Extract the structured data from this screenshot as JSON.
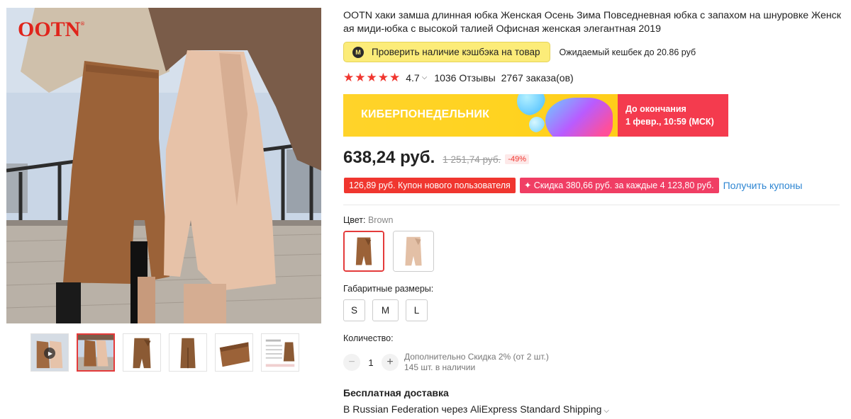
{
  "gallery": {
    "brand_logo": "OOTN",
    "thumbnails": [
      {
        "name": "thumb-video",
        "has_video": true
      },
      {
        "name": "thumb-two-models",
        "active": true
      },
      {
        "name": "thumb-brown-front"
      },
      {
        "name": "thumb-brown-side"
      },
      {
        "name": "thumb-fabric-detail"
      },
      {
        "name": "thumb-size-chart"
      }
    ]
  },
  "product": {
    "title": "OOTN хаки замша длинная юбка Женская Осень Зима Повседневная юбка с запахом на шнуровке Женская миди-юбка с высокой талией Офисная женская элегантная 2019",
    "cashback_button": "Проверить наличие кэшбэка на товар",
    "cashback_icon_letter": "M",
    "cashback_note": "Ожидаемый кешбек до 20.86 руб",
    "rating": "4.7",
    "reviews": "1036 Отзывы",
    "orders": "2767 заказа(ов)"
  },
  "promo": {
    "title": "КИБЕРПОНЕДЕЛЬНИК",
    "countdown_line1": "До окончания",
    "countdown_line2": "1 февр., 10:59 (МСК)"
  },
  "pricing": {
    "price": "638,24 руб.",
    "old_price": "1 251,74 руб.",
    "discount": "-49%"
  },
  "coupons": {
    "new_user": "126,89 руб. Купон нового пользователя",
    "store_discount": "✦ Скидка 380,66 руб. за каждые 4 123,80 руб.",
    "get_link": "Получить купоны"
  },
  "options": {
    "color_label": "Цвет: ",
    "color_value": "Brown",
    "size_label": "Габаритные размеры:",
    "sizes": [
      "S",
      "M",
      "L"
    ]
  },
  "quantity": {
    "label": "Количество:",
    "value": "1",
    "minus": "−",
    "plus": "+",
    "discount_note": "Дополнительно Скидка 2% (от 2 шт.)",
    "stock": "145 шт. в наличии"
  },
  "shipping": {
    "title": "Бесплатная доставка",
    "description": "В Russian Federation через AliExpress Standard Shipping"
  },
  "colors": {
    "accent_red": "#f0362f",
    "cashback_yellow": "#fcec79",
    "promo_yellow": "#ffd32a",
    "promo_pink": "#f43b4e",
    "link_blue": "#2e86d2",
    "skirt_brown": "#9b6238",
    "skirt_beige": "#e7c2a8"
  }
}
